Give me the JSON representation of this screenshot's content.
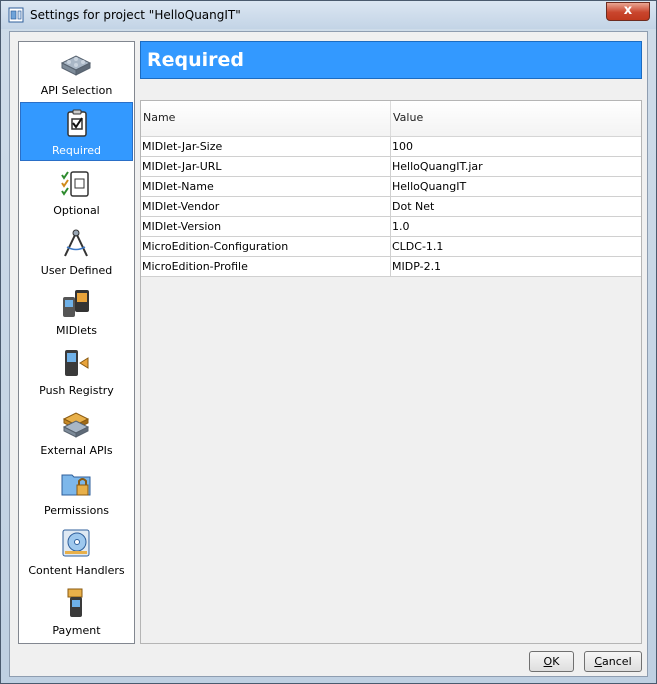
{
  "window": {
    "title": "Settings for project \"HelloQuangIT\"",
    "close_label": "x"
  },
  "sidebar": {
    "selected_index": 1,
    "items": [
      {
        "label": "API Selection",
        "icon": "api-blocks-icon"
      },
      {
        "label": "Required",
        "icon": "clipboard-check-icon"
      },
      {
        "label": "Optional",
        "icon": "checklist-icon"
      },
      {
        "label": "User Defined",
        "icon": "compass-icon"
      },
      {
        "label": "MIDlets",
        "icon": "phones-icon"
      },
      {
        "label": "Push Registry",
        "icon": "phone-push-icon"
      },
      {
        "label": "External APIs",
        "icon": "external-blocks-icon"
      },
      {
        "label": "Permissions",
        "icon": "folder-lock-icon"
      },
      {
        "label": "Content Handlers",
        "icon": "disc-handler-icon"
      },
      {
        "label": "Payment",
        "icon": "phone-payment-icon"
      }
    ]
  },
  "header": {
    "title": "Required"
  },
  "table": {
    "columns": [
      "Name",
      "Value"
    ],
    "rows": [
      {
        "name": "MIDlet-Jar-Size",
        "value": "100"
      },
      {
        "name": "MIDlet-Jar-URL",
        "value": "HelloQuangIT.jar"
      },
      {
        "name": "MIDlet-Name",
        "value": "HelloQuangIT"
      },
      {
        "name": "MIDlet-Vendor",
        "value": "Dot Net"
      },
      {
        "name": "MIDlet-Version",
        "value": "1.0"
      },
      {
        "name": "MicroEdition-Configuration",
        "value": "CLDC-1.1"
      },
      {
        "name": "MicroEdition-Profile",
        "value": "MIDP-2.1"
      }
    ]
  },
  "buttons": {
    "ok_label": "OK",
    "ok_mnemonic": "O",
    "ok_rest": "K",
    "cancel_label": "Cancel",
    "cancel_mnemonic": "C",
    "cancel_rest": "ancel"
  },
  "colors": {
    "accent": "#3399ff",
    "window_frame": "#c3d4e6",
    "close_button": "#c9452d"
  }
}
